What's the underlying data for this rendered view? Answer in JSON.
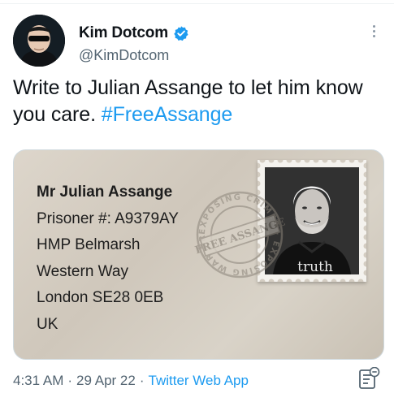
{
  "author": {
    "display_name": "Kim Dotcom",
    "handle": "@KimDotcom",
    "verified": true
  },
  "tweet": {
    "text": "Write to Julian Assange to let him know you care. ",
    "hashtag": "#FreeAssange"
  },
  "media": {
    "address_lines": [
      "Mr Julian Assange",
      "Prisoner #: A9379AY",
      "HMP Belmarsh",
      "Western Way",
      "London SE28 0EB",
      "UK"
    ],
    "stamp_shirt_text": "truth",
    "postmark_text": "FREE ASSANGE",
    "postmark_ring_text": "EXPOSING CRIMES · EXPOSING WAR CRIMES ·"
  },
  "meta": {
    "time": "4:31 AM",
    "sep1": "·",
    "date": "29 Apr 22",
    "sep2": "·",
    "source": "Twitter Web App"
  },
  "icons": {
    "verified": "verified-badge-icon",
    "more": "more-options-icon",
    "analytics": "view-analytics-icon"
  },
  "colors": {
    "accent": "#1d9bf0",
    "text": "#0f1419",
    "secondary": "#536471",
    "card_background": "#d6cfc3"
  }
}
